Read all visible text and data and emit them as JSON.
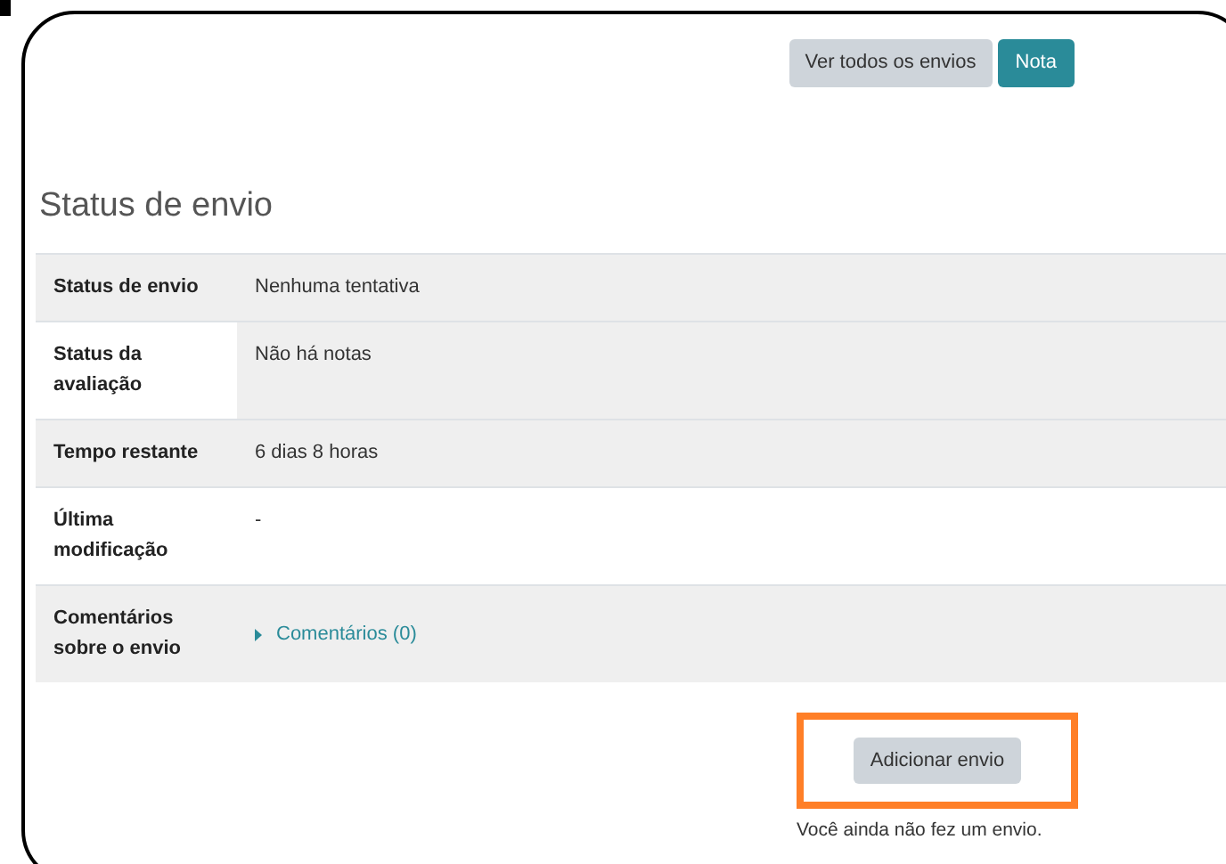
{
  "actions": [
    {
      "label": "Ver todos os envios",
      "kind": "secondary"
    },
    {
      "label": "Nota",
      "kind": "primary"
    }
  ],
  "heading": "Status de envio",
  "rows": [
    {
      "label": "Status de envio",
      "value": "Nenhuma tentativa",
      "kind": "text",
      "label_shaded": true,
      "value_shaded": true
    },
    {
      "label": "Status da avaliação",
      "value": "Não há notas",
      "kind": "text",
      "label_shaded": false,
      "value_shaded": true
    },
    {
      "label": "Tempo restante",
      "value": "6 dias 8 horas",
      "kind": "text",
      "label_shaded": true,
      "value_shaded": true
    },
    {
      "label": "Última modificação",
      "value": "-",
      "kind": "text",
      "label_shaded": false,
      "value_shaded": false
    },
    {
      "label": "Comentários sobre o envio",
      "value": "Comentários (0)",
      "kind": "toggle",
      "label_shaded": true,
      "value_shaded": true
    }
  ],
  "submit": {
    "label": "Adicionar envio",
    "highlighted": true
  },
  "note": "Você ainda não fez um envio."
}
